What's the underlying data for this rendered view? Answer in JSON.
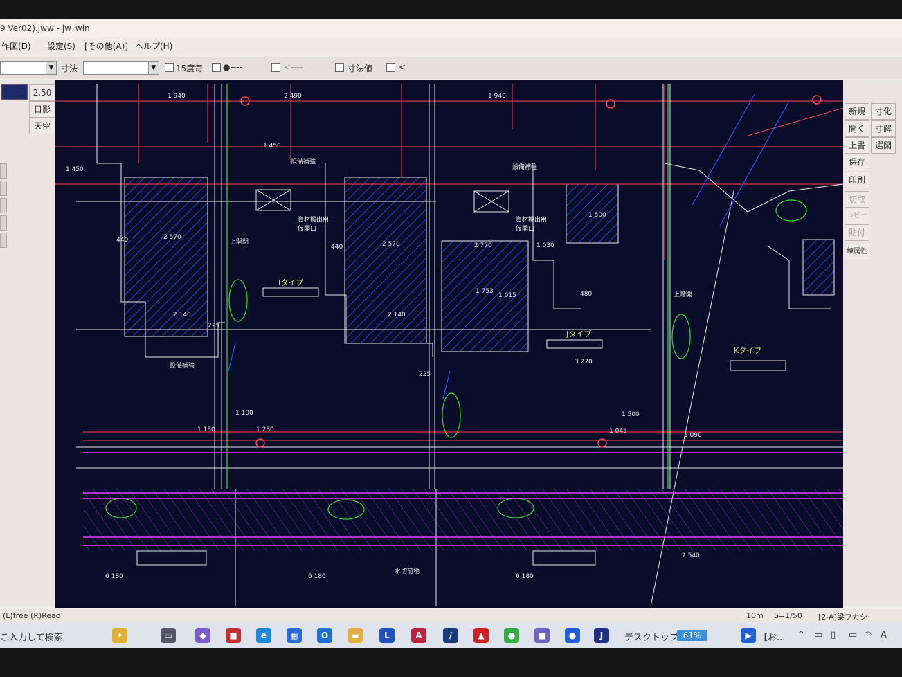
{
  "window": {
    "title": "9 Ver02).jww - jw_win"
  },
  "menu": [
    {
      "label": "作図(D)"
    },
    {
      "label": "設定(S)"
    },
    {
      "label": "[その他(A)]"
    },
    {
      "label": "ヘルプ(H)"
    }
  ],
  "toolbar": {
    "dimension_label": "寸法",
    "check_15deg": "15度毎",
    "check_dot": "●----",
    "check_arrow": "<----",
    "check_dimvalue": "寸法値",
    "check_lt": "<"
  },
  "left_panel": {
    "scale_value": "2.50",
    "buttons": [
      "日影",
      "天空"
    ]
  },
  "right_panel": {
    "col1": [
      {
        "label": "新規",
        "enabled": true
      },
      {
        "label": "開く",
        "enabled": true
      },
      {
        "label": "上書",
        "enabled": true
      },
      {
        "label": "保存",
        "enabled": true
      },
      {
        "label": "印刷",
        "enabled": true
      },
      {
        "label": "切取",
        "enabled": false
      },
      {
        "label": "コピー",
        "enabled": false
      },
      {
        "label": "貼付",
        "enabled": false
      },
      {
        "label": "線属性",
        "enabled": true
      }
    ],
    "col2": [
      {
        "label": "寸化"
      },
      {
        "label": "寸解"
      },
      {
        "label": "選図"
      }
    ]
  },
  "drawing": {
    "labels": {
      "type_i": "Iタイプ",
      "type_j": "Jタイプ",
      "type_k": "Kタイプ",
      "d1": "1 940",
      "d2": "2 490",
      "d3": "1 940",
      "d4": "2 570",
      "d5": "2 570",
      "d6": "2 770",
      "d7": "1 030",
      "d8": "2 140",
      "d9": "2 140",
      "d10": "1 753",
      "d11": "1 450",
      "d12": "1 450",
      "d13": "1 100",
      "d14": "1 130",
      "d15": "1 230",
      "d16": "1 500",
      "d17": "1 045",
      "d18": "1 090",
      "d19": "6 180",
      "d20": "6 180",
      "d21": "6 180",
      "d22": "3 270",
      "d23": "2 540",
      "d24": "440",
      "d25": "440",
      "d26": "480",
      "d27": "225",
      "d28": "225",
      "d29": "1 500",
      "d30": "1 015",
      "t1": "設備補強",
      "t2": "設備補強",
      "t3": "設備補強",
      "t4": "資材搬出用\n仮開口",
      "t5": "資材搬出用\n仮開口",
      "t6": "上開閉",
      "t7": "上階開",
      "t8": "水切前地"
    }
  },
  "status": {
    "left": "(L)free  (R)Read",
    "scale_unit": "10m",
    "scale": "S=1/50",
    "layer": "[2-A]梁フカシ"
  },
  "taskbar": {
    "search": "こ入力して検索",
    "desktop": "デスクトップ",
    "battery": "61%",
    "app_label": "【お..."
  },
  "colors": {
    "drawing_bg": "#0a0d2a",
    "red": "#ff4050",
    "blue": "#3050ff",
    "magenta": "#e040ff",
    "green": "#30e030",
    "white": "#e8e8e8",
    "yellow": "#e0e060"
  }
}
